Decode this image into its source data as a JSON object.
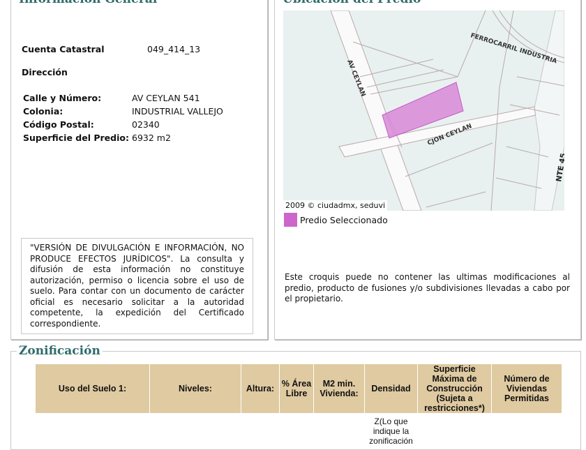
{
  "general": {
    "title": "Información General",
    "cuenta_label": "Cuenta Catastral",
    "cuenta_value": "049_414_13",
    "direccion_label": "Dirección",
    "fields": [
      {
        "label": "Calle y Número:",
        "value": "AV CEYLAN 541"
      },
      {
        "label": "Colonia:",
        "value": "INDUSTRIAL VALLEJO"
      },
      {
        "label": "Código Postal:",
        "value": "02340"
      },
      {
        "label": "Superficie del Predio:",
        "value": "6932 m2"
      }
    ],
    "disclaimer": "\"VERSIÓN DE DIVULGACIÓN E INFORMACIÓN, NO PRODUCE EFECTOS JURÍDICOS\". La consulta y difusión de esta información no constituye autorización, permiso o licencia sobre el uso de suelo. Para contar con un documento de carácter oficial es necesario solicitar a la autoridad competente, la expedición del Certificado correspondiente."
  },
  "location": {
    "title": "Ubicación del Predio",
    "streets": [
      "AV CEYLAN",
      "FERROCARRIL INDUSTRIA",
      "CJON CEYLAN",
      "NTE 45"
    ],
    "credit": "2009 © ciudadmx, seduvi",
    "legend_label": "Predio Seleccionado",
    "legend_color": "#cc66cc",
    "note": "Este croquis puede no contener las ultimas modificaciones al predio, producto de fusiones y/o subdivisiones llevadas a cabo por el propietario."
  },
  "zoning": {
    "title": "Zonificación",
    "headers": [
      "Uso del Suelo 1:",
      "Niveles:",
      "Altura:",
      "% Área Libre",
      "M2 min. Vivienda:",
      "Densidad",
      "Superficie Máxima de Construcción (Sujeta a restricciones*)",
      "Número de Viviendas Permitidas"
    ],
    "row": [
      "",
      "",
      "",
      "",
      "",
      "Z(Lo que indique la zonificación",
      "",
      ""
    ]
  }
}
